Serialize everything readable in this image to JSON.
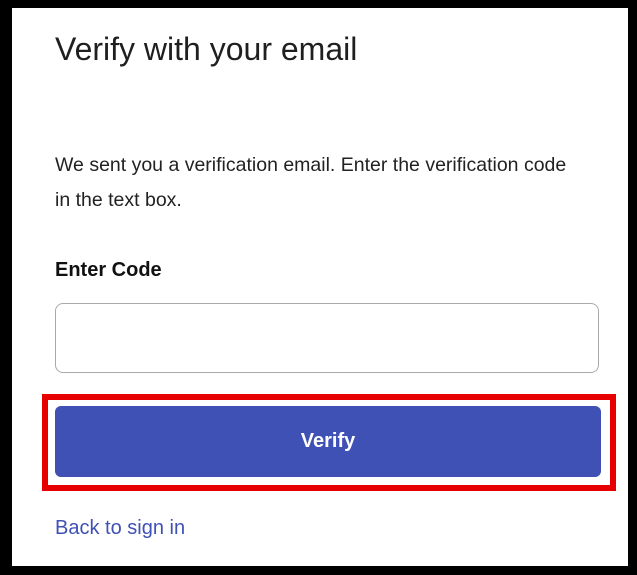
{
  "page": {
    "title": "Verify with your email",
    "description": "We sent you a verification email. Enter the verification code in the text box."
  },
  "form": {
    "code_label": "Enter Code",
    "code_value": "",
    "code_placeholder": "",
    "verify_label": "Verify",
    "back_link": "Back to sign in"
  },
  "colors": {
    "accent": "#3f51b5",
    "highlight": "#e60000"
  }
}
